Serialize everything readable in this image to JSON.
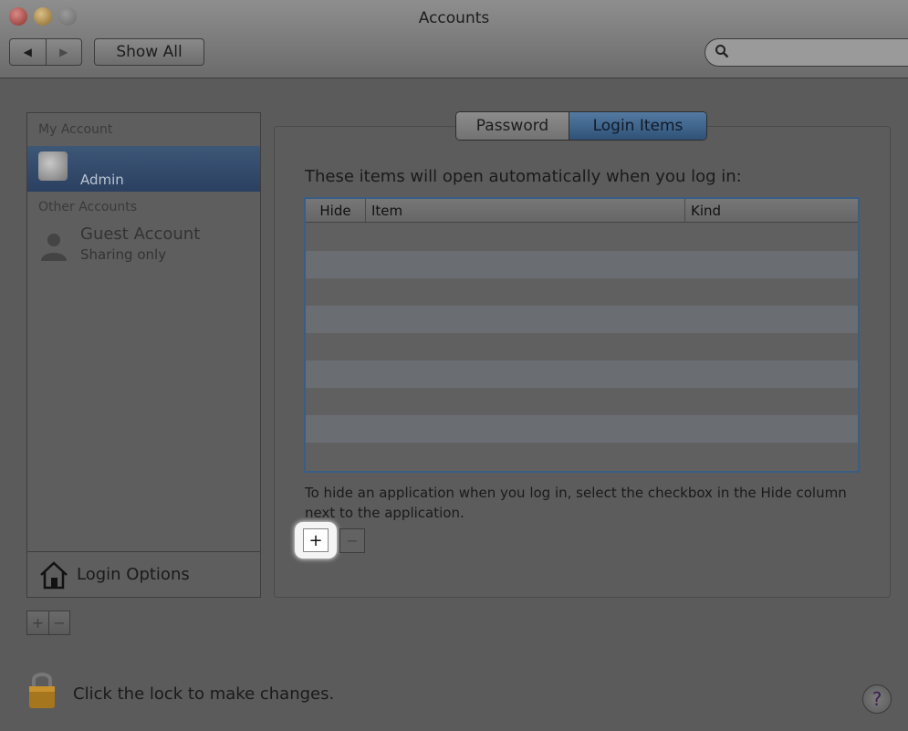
{
  "window": {
    "title": "Accounts"
  },
  "toolbar": {
    "back_glyph": "◀",
    "forward_glyph": "▶",
    "show_all_label": "Show All",
    "search_placeholder": ""
  },
  "sidebar": {
    "my_account_header": "My Account",
    "admin_name": "Admin",
    "other_accounts_header": "Other Accounts",
    "guest_name": "Guest Account",
    "guest_subtitle": "Sharing only",
    "login_options_label": "Login Options",
    "add_glyph": "+",
    "remove_glyph": "−"
  },
  "tabs": {
    "password_label": "Password",
    "login_items_label": "Login Items",
    "selected": "Login Items"
  },
  "login_items": {
    "intro": "These items will open automatically when you log in:",
    "columns": [
      "Hide",
      "Item",
      "Kind"
    ],
    "rows": [],
    "hint": "To hide an application when you log in, select the checkbox in the Hide column next to the application.",
    "add_glyph": "+",
    "remove_glyph": "−"
  },
  "footer": {
    "lock_text": "Click the lock to make changes.",
    "help_glyph": "?"
  },
  "colors": {
    "selection": "#2b4061",
    "tab_selected": "#2f5277",
    "table_focus": "#3a5d86"
  }
}
